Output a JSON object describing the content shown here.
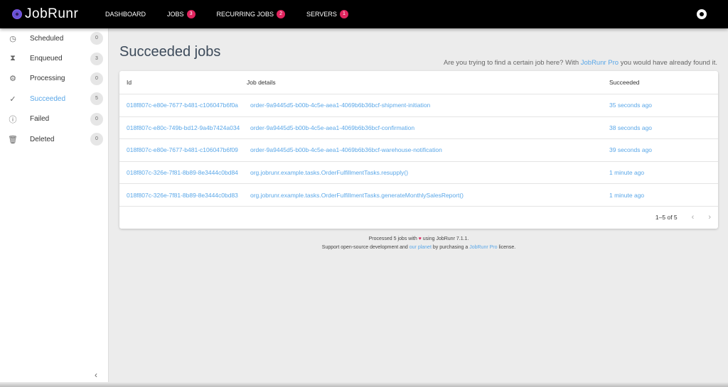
{
  "app": {
    "name": "JobRunr"
  },
  "nav": [
    {
      "label": "DASHBOARD"
    },
    {
      "label": "JOBS",
      "badge": "3"
    },
    {
      "label": "RECURRING JOBS",
      "badge": "2"
    },
    {
      "label": "SERVERS",
      "badge": "1"
    }
  ],
  "sidebar": [
    {
      "label": "Scheduled",
      "count": "0",
      "icon": "clock-icon"
    },
    {
      "label": "Enqueued",
      "count": "3",
      "icon": "hourglass-icon"
    },
    {
      "label": "Processing",
      "count": "0",
      "icon": "gears-icon"
    },
    {
      "label": "Succeeded",
      "count": "5",
      "icon": "check-icon"
    },
    {
      "label": "Failed",
      "count": "0",
      "icon": "alert-icon"
    },
    {
      "label": "Deleted",
      "count": "0",
      "icon": "trash-icon"
    }
  ],
  "page": {
    "title": "Succeeded jobs",
    "hint_pre": "Are you trying to find a certain job here? With ",
    "hint_link": "JobRunr Pro",
    "hint_post": " you would have already found it."
  },
  "table": {
    "headers": [
      "Id",
      "Job details",
      "Succeeded"
    ],
    "rows": [
      [
        "018f807c-e80e-7677-b481-c106047b6f0a",
        "order-9a9445d5-b00b-4c5e-aea1-4069b6b36bcf-shipment-initiation",
        "35 seconds ago"
      ],
      [
        "018f807c-e80c-749b-bd12-9a4b7424a034",
        "order-9a9445d5-b00b-4c5e-aea1-4069b6b36bcf-confirmation",
        "38 seconds ago"
      ],
      [
        "018f807c-e80e-7677-b481-c106047b6f09",
        "order-9a9445d5-b00b-4c5e-aea1-4069b6b36bcf-warehouse-notification",
        "39 seconds ago"
      ],
      [
        "018f807c-326e-7f81-8b89-8e3444c0bd84",
        "org.jobrunr.example.tasks.OrderFulfillmentTasks.resupply()",
        "1 minute ago"
      ],
      [
        "018f807c-326e-7f81-8b89-8e3444c0bd83",
        "org.jobrunr.example.tasks.OrderFulfillmentTasks.generateMonthlySalesReport()",
        "1 minute ago"
      ]
    ],
    "pagination": "1–5 of 5"
  },
  "footer": {
    "l1_pre": "Processed 5 jobs with ",
    "heart": "♥",
    "l1_post": " using JobRunr 7.1.1.",
    "l2_a": "Support open-source development and ",
    "l2_link1": "our planet",
    "l2_b": " by purchasing a ",
    "l2_link2": "JobRunr Pro",
    "l2_c": " license."
  }
}
